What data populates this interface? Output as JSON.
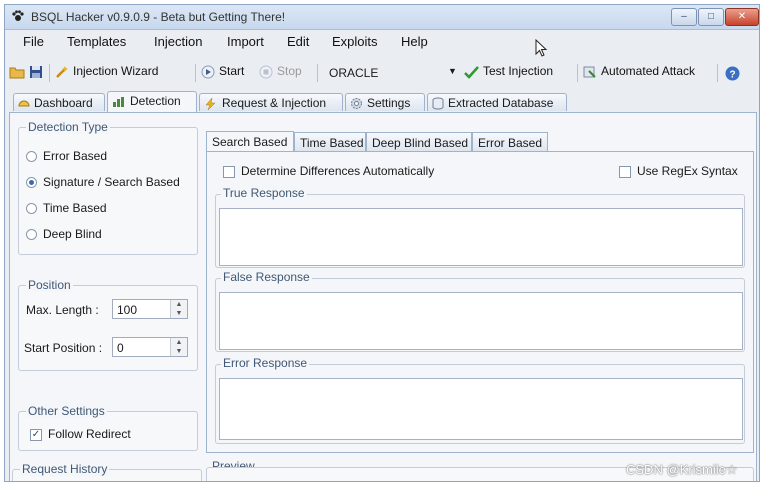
{
  "window": {
    "title": "BSQL Hacker v0.9.0.9 - Beta but Getting There!",
    "app_icon": "paw-icon",
    "min": "‒",
    "max": "□",
    "close": "✕"
  },
  "menu": [
    "File",
    "Templates",
    "Injection",
    "Import",
    "Edit",
    "Exploits",
    "Help"
  ],
  "toolbar": {
    "injection_wizard": "Injection Wizard",
    "start": "Start",
    "stop": "Stop",
    "db_select": "ORACLE",
    "test_injection": "Test Injection",
    "automated_attack": "Automated Attack"
  },
  "tabs": [
    "Dashboard",
    "Detection",
    "Request & Injection",
    "Settings",
    "Extracted Database"
  ],
  "active_tab": "Detection",
  "detection_type": {
    "label": "Detection Type",
    "options": [
      "Error Based",
      "Signature / Search Based",
      "Time Based",
      "Deep Blind"
    ],
    "selected": "Signature / Search Based"
  },
  "position": {
    "label": "Position",
    "max_length_label": "Max. Length :",
    "max_length": "100",
    "start_position_label": "Start Position :",
    "start_position": "0"
  },
  "other_settings": {
    "label": "Other Settings",
    "follow_redirect": "Follow Redirect",
    "checkmark": "✓"
  },
  "request_history": {
    "label": "Request History"
  },
  "sub_tabs": [
    "Search Based",
    "Time Based",
    "Deep Blind Based",
    "Error Based"
  ],
  "search_panel": {
    "determine_diff": "Determine Differences Automatically",
    "use_regex": "Use RegEx Syntax",
    "true_response": "True Response",
    "false_response": "False Response",
    "error_response": "Error Response"
  },
  "preview": {
    "label": "Preview"
  },
  "watermark": "CSDN @Krismile☆",
  "colors": {
    "accent": "#3d6aa8",
    "title_bg": "#c7d8ee",
    "close_btn": "#c7432c"
  }
}
